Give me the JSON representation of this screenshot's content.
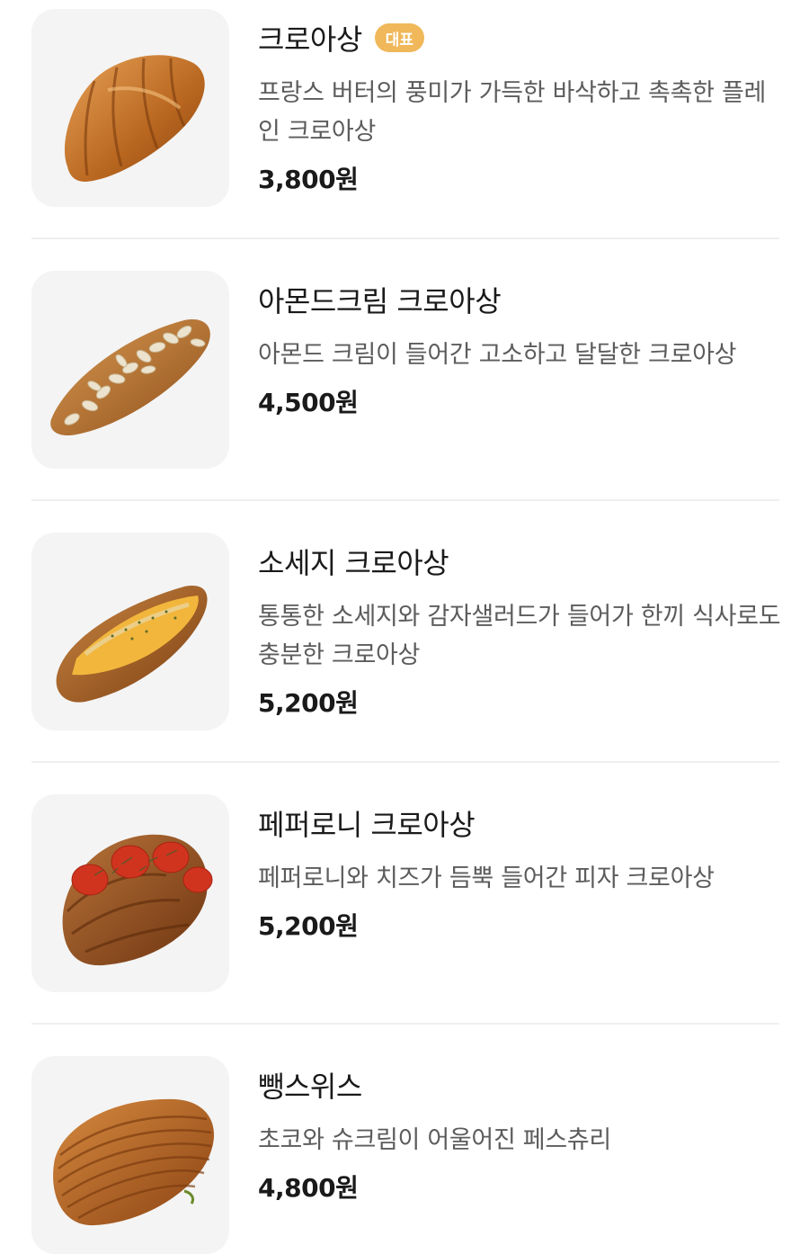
{
  "menu": {
    "items": [
      {
        "name": "크로아상",
        "badge": "대표",
        "description": "프랑스 버터의 풍미가 가득한 바삭하고 촉촉한 플레인 크로아상",
        "price": "3,800원",
        "image_icon": "croissant-plain-photo"
      },
      {
        "name": "아몬드크림 크로아상",
        "description": "아몬드 크림이 들어간 고소하고 달달한 크로아상",
        "price": "4,500원",
        "image_icon": "croissant-almond-photo"
      },
      {
        "name": "소세지 크로아상",
        "description": "통통한 소세지와 감자샐러드가 들어가 한끼 식사로도 충분한 크로아상",
        "price": "5,200원",
        "image_icon": "croissant-sausage-photo"
      },
      {
        "name": "페퍼로니 크로아상",
        "description": "페퍼로니와 치즈가 듬뿍 들어간 피자 크로아상",
        "price": "5,200원",
        "image_icon": "croissant-pepperoni-photo"
      },
      {
        "name": "뺑스위스",
        "description": "초코와 슈크림이 어울어진 페스츄리",
        "price": "4,800원",
        "image_icon": "pain-suisse-photo"
      }
    ]
  },
  "colors": {
    "badge": "#f0b85a",
    "thumb_bg": "#f4f4f4",
    "divider": "#efefef"
  }
}
